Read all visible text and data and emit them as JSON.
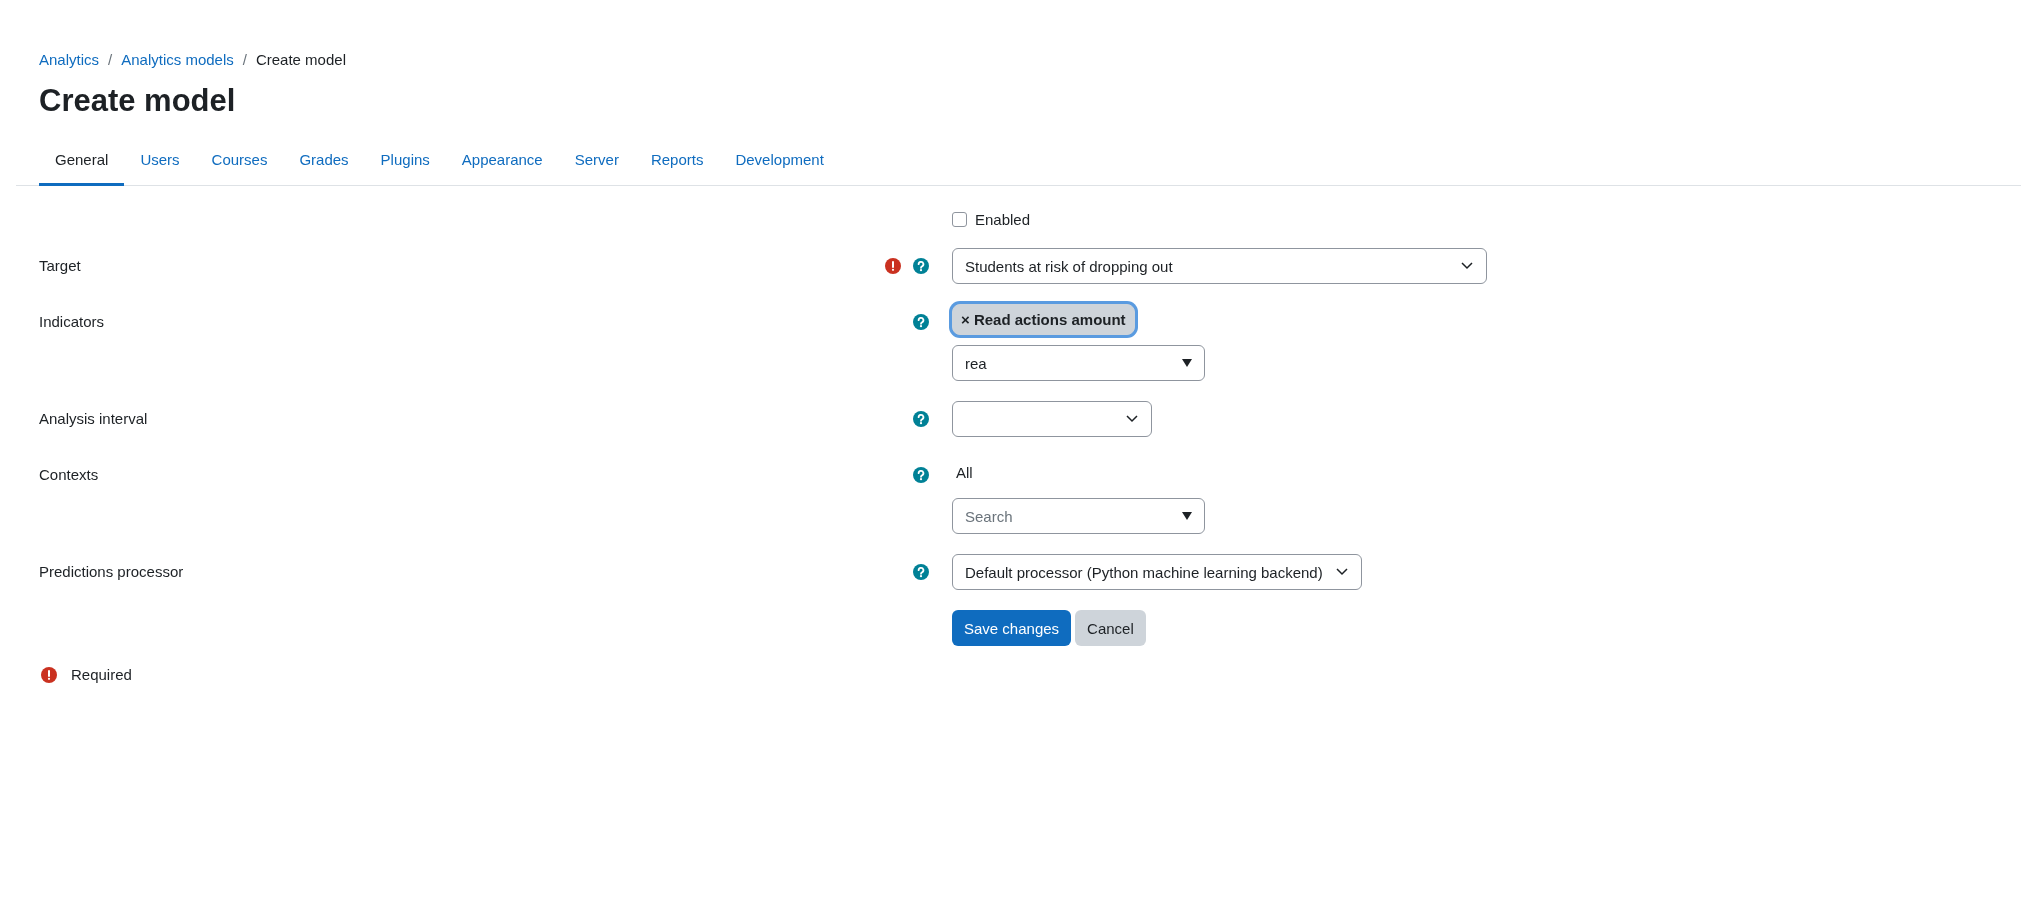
{
  "breadcrumb": [
    {
      "label": "Analytics",
      "link": true
    },
    {
      "sep": "/",
      "label": "Analytics models",
      "link": true
    },
    {
      "sep": "/",
      "label": "Create model",
      "link": false
    }
  ],
  "title": "Create model",
  "tabs": [
    {
      "label": "General",
      "selected": true
    },
    {
      "label": "Users",
      "selected": false
    },
    {
      "label": "Courses",
      "selected": false
    },
    {
      "label": "Grades",
      "selected": false
    },
    {
      "label": "Plugins",
      "selected": false
    },
    {
      "label": "Appearance",
      "selected": false
    },
    {
      "label": "Server",
      "selected": false
    },
    {
      "label": "Reports",
      "selected": false
    },
    {
      "label": "Development",
      "selected": false
    }
  ],
  "form": {
    "enabled": {
      "label": "Enabled",
      "checked": false
    },
    "fields": [
      {
        "label": "Target",
        "kind": "select",
        "required": true,
        "help": true,
        "value": "Students at risk of dropping out"
      },
      {
        "label": "Indicators",
        "kind": "autocomplete",
        "required": false,
        "help": true,
        "chips": [
          {
            "remove": "×",
            "label": "Read actions amount",
            "focused": true
          }
        ],
        "value": "rea"
      },
      {
        "label": "Analysis interval",
        "kind": "select",
        "required": false,
        "help": true
      },
      {
        "label": "Contexts",
        "kind": "autocomplete",
        "required": false,
        "help": true,
        "selection": "All",
        "placeholder": "Search"
      },
      {
        "label": "Predictions processor",
        "kind": "select",
        "required": false,
        "help": true,
        "value": "Default processor (Python machine learning backend)"
      }
    ],
    "buttons": [
      {
        "label": "Save changes",
        "kind": "primary"
      },
      {
        "label": "Cancel",
        "kind": "secondary"
      }
    ]
  },
  "required_note": "Required"
}
